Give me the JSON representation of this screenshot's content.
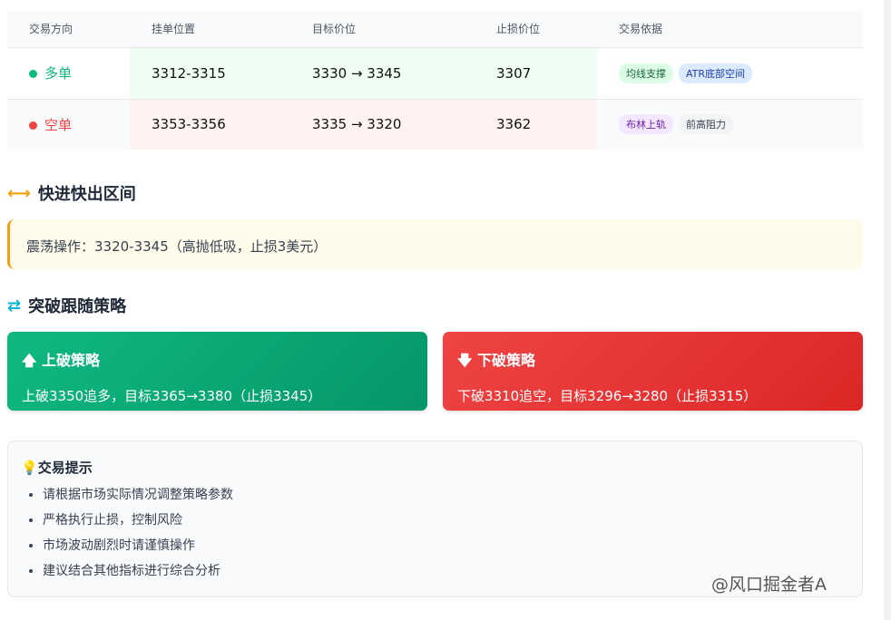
{
  "table": {
    "headers": [
      "交易方向",
      "挂单位置",
      "目标价位",
      "止损价位",
      "交易依据"
    ],
    "rows": [
      {
        "direction": "多单",
        "color": "#10b981",
        "entry": "3312-3315",
        "target": "3330 → 3345",
        "stop": "3307",
        "tags": [
          "均线支撑",
          "ATR底部空间"
        ]
      },
      {
        "direction": "空单",
        "color": "#ef4444",
        "entry": "3353-3356",
        "target": "3335 → 3320",
        "stop": "3362",
        "tags": [
          "布林上轨",
          "前高阻力"
        ]
      }
    ]
  },
  "quick": {
    "title": "快进快出区间",
    "text": "震荡操作：3320-3345（高抛低吸，止损3美元）"
  },
  "breakout": {
    "title": "突破跟随策略",
    "up": {
      "title": "上破策略",
      "text": "上破3350追多，目标3365→3380（止损3345）"
    },
    "down": {
      "title": "下破策略",
      "text": "下破3310追空，目标3296→3280（止损3315）"
    }
  },
  "tips": {
    "title": "交易提示",
    "items": [
      "请根据市场实际情况调整策略参数",
      "严格执行止损，控制风险",
      "市场波动剧烈时请谨慎操作",
      "建议结合其他指标进行综合分析"
    ]
  },
  "watermark": "@风口掘金者A"
}
